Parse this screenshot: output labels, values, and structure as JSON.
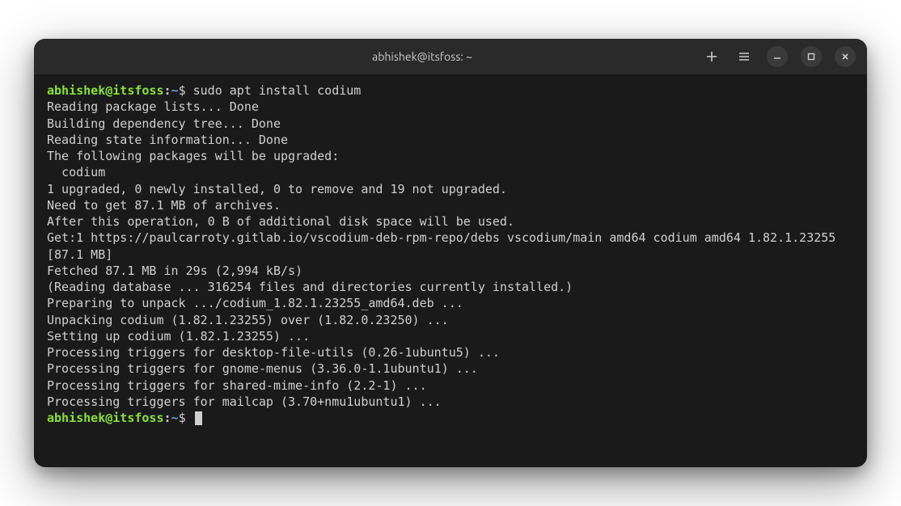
{
  "titlebar": {
    "title": "abhishek@itsfoss: ~"
  },
  "prompt": {
    "user_host": "abhishek@itsfoss",
    "colon": ":",
    "path": "~",
    "symbol": "$"
  },
  "command": "sudo apt install codium",
  "output": [
    "Reading package lists... Done",
    "Building dependency tree... Done",
    "Reading state information... Done",
    "The following packages will be upgraded:",
    "  codium",
    "1 upgraded, 0 newly installed, 0 to remove and 19 not upgraded.",
    "Need to get 87.1 MB of archives.",
    "After this operation, 0 B of additional disk space will be used.",
    "Get:1 https://paulcarroty.gitlab.io/vscodium-deb-rpm-repo/debs vscodium/main amd64 codium amd64 1.82.1.23255 [87.1 MB]",
    "Fetched 87.1 MB in 29s (2,994 kB/s)",
    "(Reading database ... 316254 files and directories currently installed.)",
    "Preparing to unpack .../codium_1.82.1.23255_amd64.deb ...",
    "Unpacking codium (1.82.1.23255) over (1.82.0.23250) ...",
    "Setting up codium (1.82.1.23255) ...",
    "Processing triggers for desktop-file-utils (0.26-1ubuntu5) ...",
    "Processing triggers for gnome-menus (3.36.0-1.1ubuntu1) ...",
    "Processing triggers for shared-mime-info (2.2-1) ...",
    "Processing triggers for mailcap (3.70+nmu1ubuntu1) ..."
  ]
}
